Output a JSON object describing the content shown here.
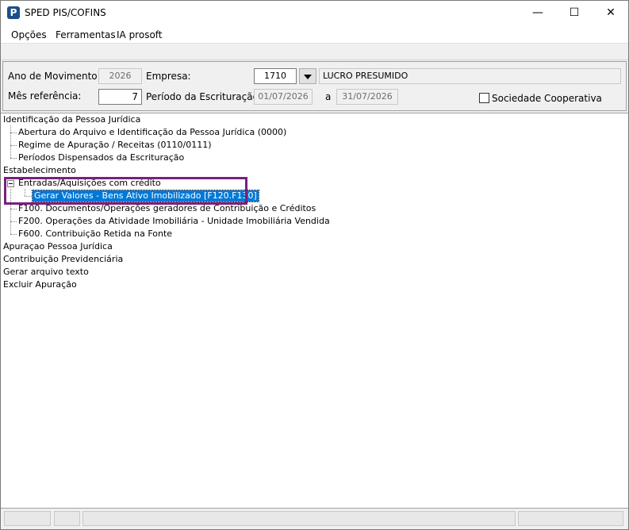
{
  "window": {
    "title": "SPED PIS/COFINS",
    "icon_letter": "P"
  },
  "menu": {
    "items": [
      "Opções",
      "Ferramentas",
      "IA prosoft"
    ]
  },
  "form": {
    "ano_label": "Ano de Movimento:",
    "ano_value": "2026",
    "empresa_label": "Empresa:",
    "empresa_code": "1710",
    "empresa_regime": "LUCRO PRESUMIDO",
    "mes_label": "Mês referência:",
    "mes_value": "7",
    "periodo_label": "Período da Escrituração:",
    "periodo_inicio": "01/07/2026",
    "periodo_sep": "a",
    "periodo_fim": "31/07/2026",
    "cooperativa_label": "Sociedade Cooperativa",
    "cooperativa_checked": false
  },
  "tree": {
    "items": [
      "Identificação da Pessoa Jurídica",
      "Abertura do Arquivo e Identificação da Pessoa Jurídica (0000)",
      "Regime de Apuração / Receitas (0110/0111)",
      "Períodos Dispensados da Escrituração",
      "Estabelecimento",
      "Entradas/Aquisições com crédito",
      "Gerar Valores - Bens Ativo Imobilizado   [F120.F130]",
      "F100. Documentos/Operações geradores de Contribuição e Créditos",
      "F200. Operações da Atividade Imobiliária - Unidade Imobiliária Vendida",
      "F600. Contribuição Retida na Fonte",
      "Apuraçao Pessoa Jurídica",
      "Contribuição Previdenciária",
      "Gerar arquivo texto",
      "Excluir Apuração"
    ],
    "selected_item": "Gerar Valores - Bens Ativo Imobilizado   [F120.F130]"
  },
  "colors": {
    "selection": "#0078d7",
    "highlight_border": "#7b1f7e",
    "app_icon": "#1c4f8a"
  }
}
